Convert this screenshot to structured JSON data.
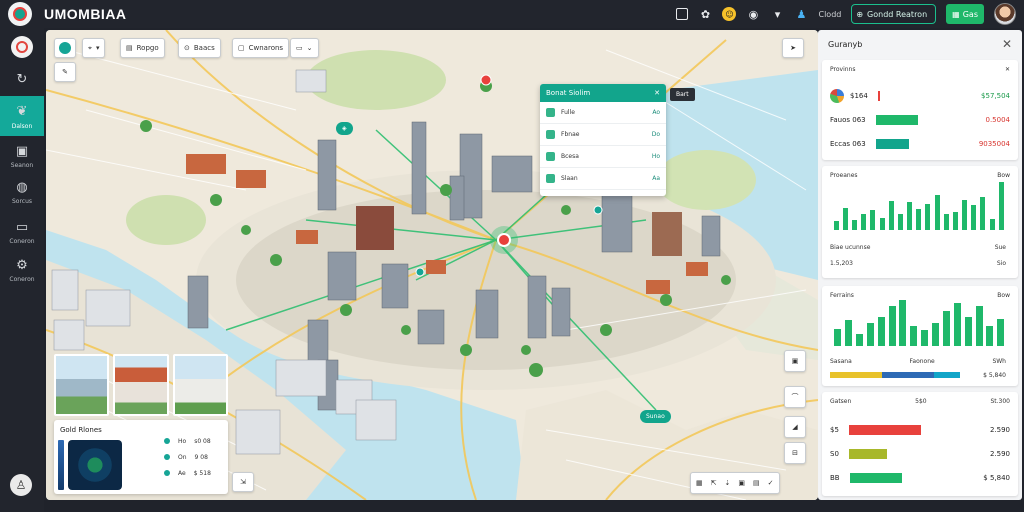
{
  "app": {
    "title": "UMOMBIAA"
  },
  "topbar": {
    "status_text": "Clodd",
    "search_label": "Gondd Reatron",
    "action_label": "Gas"
  },
  "sidebar": {
    "items": [
      {
        "label": ""
      },
      {
        "label": "Dalson"
      },
      {
        "label": "Seanon"
      },
      {
        "label": "Sorcus"
      },
      {
        "label": "Coneron"
      }
    ]
  },
  "map_toolbar": {
    "filter_label": "Ropgo",
    "layers_label": "Baacs",
    "view_label": "Cwnarons"
  },
  "popup": {
    "title": "Bonat Siolim",
    "rows": [
      {
        "label": "Fulle",
        "value": "Ao"
      },
      {
        "label": "Fbnae",
        "value": "Do"
      },
      {
        "label": "Bcesa",
        "value": "Ho"
      },
      {
        "label": "Slaan",
        "value": "Aa"
      }
    ]
  },
  "map_chips": {
    "east": "Bart",
    "south": "Sunao"
  },
  "radar": {
    "title": "Gold Rlones",
    "rows": [
      {
        "label": "Ho",
        "value": "s0 08"
      },
      {
        "label": "On",
        "value": "9 08"
      },
      {
        "label": "Ae",
        "value": "$ 518"
      }
    ]
  },
  "panel": {
    "title": "Guranyb",
    "metrics_card": {
      "title": "Provinns",
      "rows": [
        {
          "label": "$164",
          "value": "$57,504",
          "fill": 0.0,
          "color": "#e8413c"
        },
        {
          "label": "Fauos 063",
          "value": "0.5004",
          "fill": 0.7,
          "color": "#1fb86a"
        },
        {
          "label": "Eccas 063",
          "value": "9035004",
          "fill": 0.55,
          "color": "#12a58c"
        }
      ]
    },
    "bar_card_1": {
      "title": "Proeanes",
      "value_label": "Bow",
      "footer_left": "Biae ucunnse",
      "footer_right": "Sue",
      "footer2_left": "1.5,203",
      "footer2_right": "Sio",
      "values": [
        8,
        20,
        9,
        14,
        18,
        11,
        26,
        14,
        25,
        19,
        23,
        31,
        14,
        16,
        27,
        22,
        30,
        10,
        43
      ]
    },
    "bar_card_2": {
      "title": "Ferrains",
      "value_label": "Bow",
      "footer_left": "Sasana",
      "footer_mid": "Faonone",
      "footer_right": "SWh",
      "footer2_right": "$ 5,840",
      "values": [
        12,
        18,
        8,
        16,
        20,
        28,
        32,
        14,
        11,
        16,
        24,
        30,
        20,
        28,
        14,
        19
      ]
    },
    "list_card": {
      "title": "Gatsen",
      "title_mid": "5$0",
      "title_right": "St.300",
      "rows": [
        {
          "label": "$5",
          "value": "2.590",
          "fill": 0.72,
          "color": "#e8413c"
        },
        {
          "label": "S0",
          "value": "2.590",
          "fill": 0.38,
          "color": "#a8b82a"
        },
        {
          "label": "BB",
          "value": "$ 5,840",
          "fill": 0.52,
          "color": "#1fb86a"
        }
      ]
    }
  }
}
